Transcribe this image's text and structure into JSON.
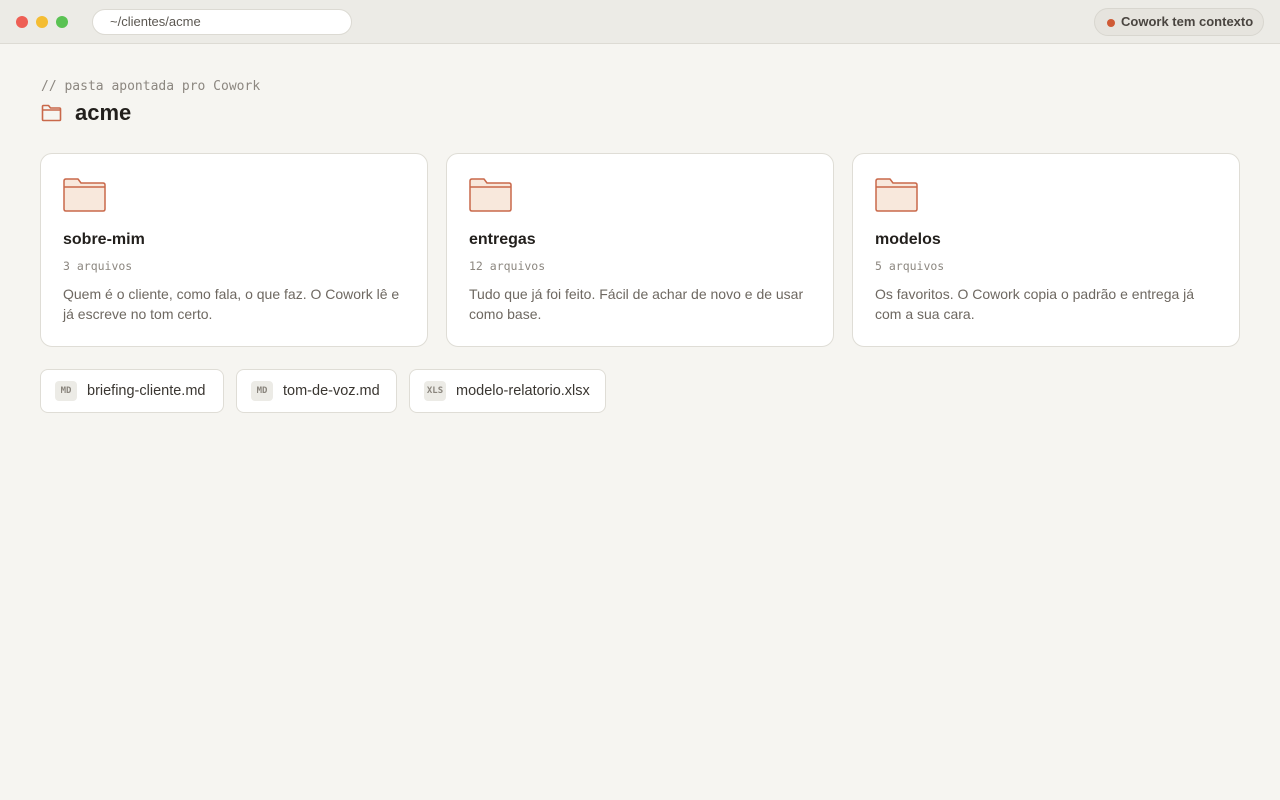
{
  "window": {
    "address": "~/clientes/acme",
    "status_badge": "Cowork tem contexto"
  },
  "header": {
    "comment": "// pasta apontada pro Cowork",
    "folder_name": "acme"
  },
  "folders": [
    {
      "name": "sobre-mim",
      "count": "3 arquivos",
      "description": "Quem é o cliente, como fala, o que faz. O Cowork lê e já escreve no tom certo.",
      "icon": "folder-icon"
    },
    {
      "name": "entregas",
      "count": "12 arquivos",
      "description": "Tudo que já foi feito. Fácil de achar de novo e de usar como base.",
      "icon": "folder-icon"
    },
    {
      "name": "modelos",
      "count": "5 arquivos",
      "description": "Os favoritos. O Cowork copia o padrão e entrega já com a sua cara.",
      "icon": "folder-icon"
    }
  ],
  "files": [
    {
      "tag": "MD",
      "name": "briefing-cliente.md"
    },
    {
      "tag": "MD",
      "name": "tom-de-voz.md"
    },
    {
      "tag": "XLS",
      "name": "modelo-relatorio.xlsx"
    }
  ],
  "colors": {
    "accent": "#cf5a35",
    "folder_fill": "#f8e8dc",
    "folder_stroke": "#c9684a",
    "background": "#f6f5f1"
  }
}
